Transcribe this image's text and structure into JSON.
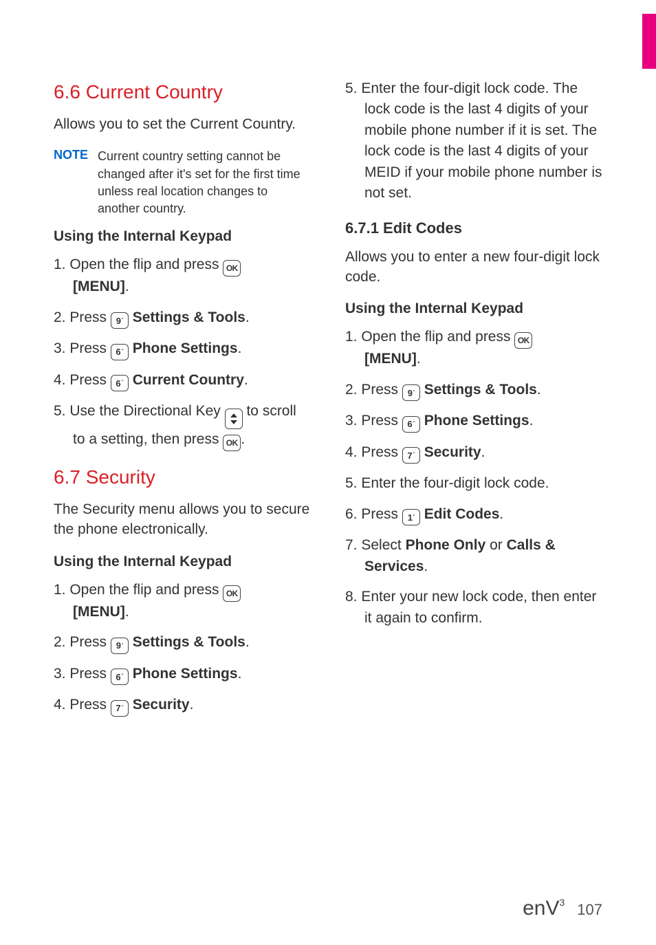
{
  "sections": {
    "s66": {
      "heading": "6.6 Current Country",
      "intro": "Allows you to set the Current Country.",
      "note_label": "NOTE",
      "note_body": "Current country setting cannot be changed after it's set for the first time unless real location changes to another country.",
      "keypad_heading": "Using the Internal Keypad",
      "step1_a": "1. Open the flip and press ",
      "step1_menu": "[MENU]",
      "step2_a": "2. Press ",
      "step2_b": "Settings & Tools",
      "step3_a": "3. Press ",
      "step3_b": "Phone Settings",
      "step4_a": "4. Press ",
      "step4_b": "Current Country",
      "step5_a": "5. Use the Directional Key ",
      "step5_b": " to scroll to a setting, then press "
    },
    "s67": {
      "heading": "6.7 Security",
      "intro": "The Security menu allows you to secure the phone electronically.",
      "keypad_heading": "Using the Internal Keypad",
      "step1_a": "1. Open the flip and press ",
      "step1_menu": "[MENU]",
      "step2_a": "2. Press ",
      "step2_b": "Settings & Tools",
      "step3_a": "3. Press ",
      "step3_b": "Phone Settings",
      "step4_a": "4. Press ",
      "step4_b": "Security",
      "step5": "5. Enter the four-digit lock code. The lock code is the last 4 digits of your mobile phone number if it is set. The lock code is the last 4 digits of your MEID if your mobile phone number is not set."
    },
    "s671": {
      "heading": "6.7.1 Edit Codes",
      "intro": "Allows you to enter a new four-digit lock code.",
      "keypad_heading": "Using the Internal Keypad",
      "step1_a": "1. Open the flip and press ",
      "step1_menu": "[MENU]",
      "step2_a": "2. Press ",
      "step2_b": "Settings & Tools",
      "step3_a": "3. Press ",
      "step3_b": "Phone Settings",
      "step4_a": "4. Press ",
      "step4_b": "Security",
      "step5": "5. Enter the four-digit lock code.",
      "step6_a": "6. Press ",
      "step6_b": "Edit Codes",
      "step7_a": "7. Select ",
      "step7_b": "Phone Only",
      "step7_c": " or ",
      "step7_d": "Calls & Services",
      "step8": "8. Enter your new lock code, then enter it again to confirm."
    }
  },
  "keys": {
    "ok": "OK",
    "k9": "9",
    "k6": "6",
    "k7": "7",
    "k1": "1"
  },
  "footer": {
    "logo": "enV",
    "logo_sup": "3",
    "page": "107"
  },
  "punct": {
    "period": ".",
    "period_end": "."
  }
}
